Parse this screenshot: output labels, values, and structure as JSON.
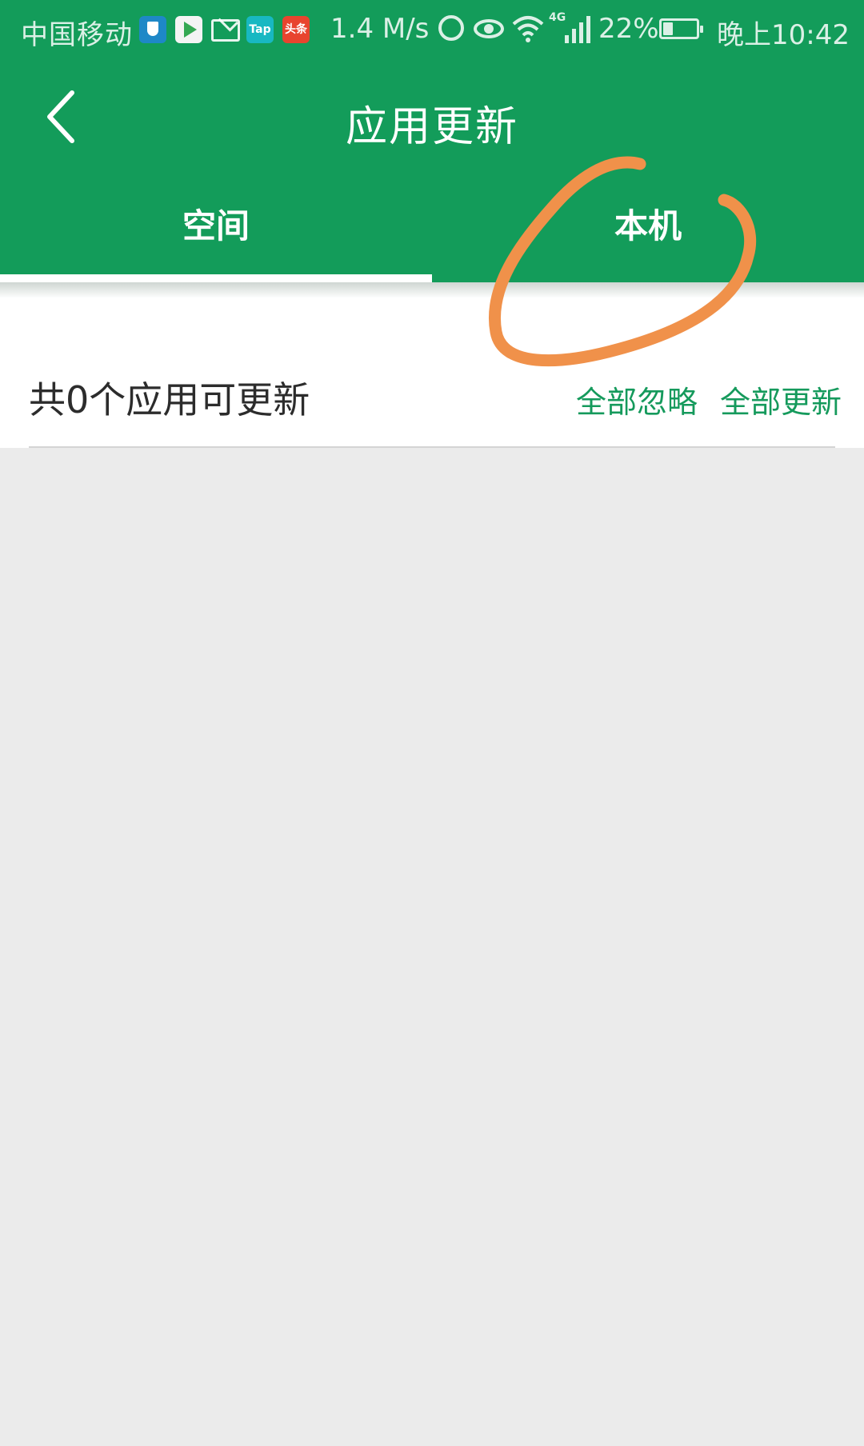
{
  "status_bar": {
    "carrier": "中国移动",
    "network_speed": "1.4 M/s",
    "network_type": "4G",
    "battery": "22%",
    "time": "晚上10:42",
    "app_icons": [
      "shield-icon",
      "play-store-icon",
      "mail-icon",
      "tap-icon",
      "toutiao-icon"
    ],
    "tap_label": "Tap",
    "toutiao_label": "头条"
  },
  "toolbar": {
    "title": "应用更新",
    "back_icon": "chevron-left-icon"
  },
  "tabs": [
    {
      "label": "空间",
      "selected": true
    },
    {
      "label": "本机",
      "selected": false
    }
  ],
  "summary": {
    "count_text": "共0个应用可更新",
    "ignore_all_label": "全部忽略",
    "update_all_label": "全部更新"
  },
  "colors": {
    "brand_green": "#139c5a",
    "link_green": "#159a5c",
    "annotation_orange": "#f0914a",
    "background": "#ebebeb"
  }
}
